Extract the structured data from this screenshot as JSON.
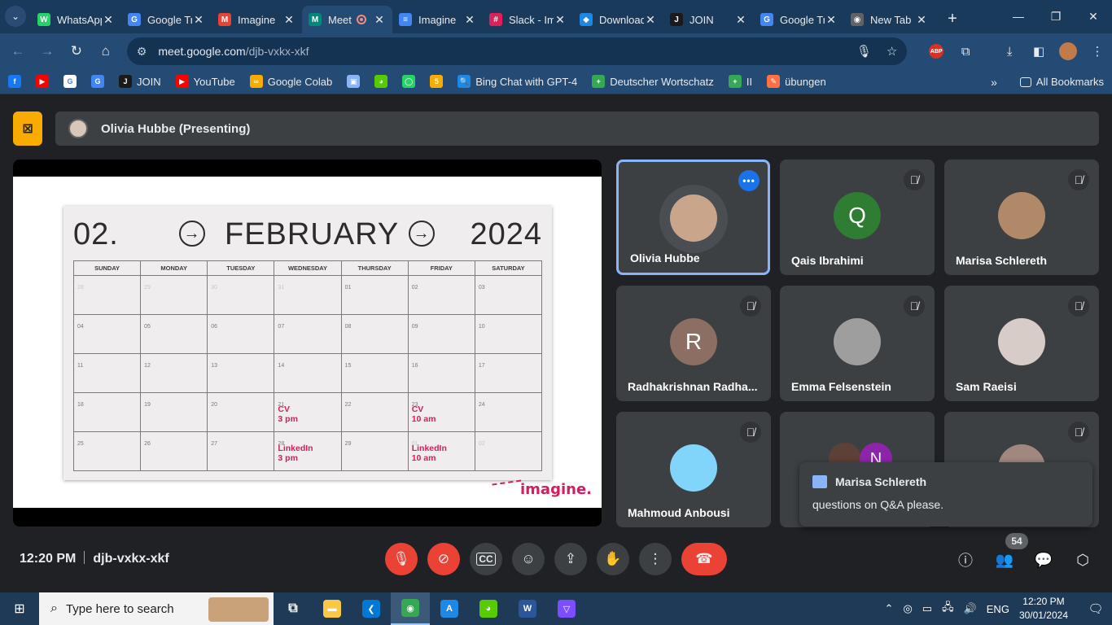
{
  "browser": {
    "tabs": [
      {
        "title": "WhatsApp",
        "icon": "whatsapp-icon",
        "color": "#25d366",
        "glyph": "W"
      },
      {
        "title": "Google Translate",
        "icon": "google-translate-icon",
        "color": "#4285f4",
        "glyph": "G"
      },
      {
        "title": "Imagine",
        "icon": "gmail-icon",
        "color": "#ea4335",
        "glyph": "M"
      },
      {
        "title": "Meet",
        "icon": "meet-icon",
        "color": "#00897b",
        "glyph": "M",
        "active": true,
        "recording": true
      },
      {
        "title": "Imagine",
        "icon": "docs-icon",
        "color": "#4285f4",
        "glyph": "≡"
      },
      {
        "title": "Slack - Imagine",
        "icon": "slack-icon",
        "color": "#e01e5a",
        "glyph": "#"
      },
      {
        "title": "Download",
        "icon": "download-site-icon",
        "color": "#1e88e5",
        "glyph": "◆"
      },
      {
        "title": "JOIN",
        "icon": "join-icon",
        "color": "#1a1a1a",
        "glyph": "J"
      },
      {
        "title": "Google Translate",
        "icon": "google-translate-icon",
        "color": "#4285f4",
        "glyph": "G"
      },
      {
        "title": "New Tab",
        "icon": "chrome-icon",
        "color": "#5f6368",
        "glyph": "◉"
      }
    ],
    "url_host": "meet.google.com",
    "url_path": "/djb-vxkx-xkf"
  },
  "bookmarks": {
    "items": [
      {
        "label": "",
        "color": "#1877f2",
        "glyph": "f"
      },
      {
        "label": "",
        "color": "#ff0000",
        "glyph": "▶"
      },
      {
        "label": "",
        "color": "#ffffff",
        "glyph": "G"
      },
      {
        "label": "",
        "color": "#4285f4",
        "glyph": "G"
      },
      {
        "label": "JOIN",
        "color": "#1a1a1a",
        "glyph": "J"
      },
      {
        "label": "YouTube",
        "color": "#ff0000",
        "glyph": "▶"
      },
      {
        "label": "Google Colab",
        "color": "#f9ab00",
        "glyph": "∞"
      },
      {
        "label": "",
        "color": "#8ab4f8",
        "glyph": "▣"
      },
      {
        "label": "",
        "color": "#58cc02",
        "glyph": "◕"
      },
      {
        "label": "",
        "color": "#25d366",
        "glyph": "◯"
      },
      {
        "label": "",
        "color": "#f9ab00",
        "glyph": "5"
      },
      {
        "label": "Bing Chat with GPT-4",
        "color": "#1e88e5",
        "glyph": "🔍"
      },
      {
        "label": "Deutscher Wortschatz",
        "color": "#34a853",
        "glyph": "+"
      },
      {
        "label": "II",
        "color": "#34a853",
        "glyph": "+"
      },
      {
        "label": "übungen",
        "color": "#ff7043",
        "glyph": "✎"
      }
    ],
    "all_bookmarks": "All Bookmarks"
  },
  "meet": {
    "presenter_label": "Olivia Hubbe (Presenting)",
    "slide": {
      "month_number": "02.",
      "month_name": "FEBRUARY",
      "year": "2024",
      "days": [
        "SUNDAY",
        "MONDAY",
        "TUESDAY",
        "WEDNESDAY",
        "THURSDAY",
        "FRIDAY",
        "SATURDAY"
      ],
      "weeks": [
        [
          {
            "d": "28",
            "faint": true
          },
          {
            "d": "29",
            "faint": true
          },
          {
            "d": "30",
            "faint": true
          },
          {
            "d": "31",
            "faint": true
          },
          {
            "d": "01"
          },
          {
            "d": "02"
          },
          {
            "d": "03"
          }
        ],
        [
          {
            "d": "04"
          },
          {
            "d": "05"
          },
          {
            "d": "06"
          },
          {
            "d": "07"
          },
          {
            "d": "08"
          },
          {
            "d": "09"
          },
          {
            "d": "10"
          }
        ],
        [
          {
            "d": "11"
          },
          {
            "d": "12"
          },
          {
            "d": "13"
          },
          {
            "d": "14"
          },
          {
            "d": "15"
          },
          {
            "d": "16"
          },
          {
            "d": "17"
          }
        ],
        [
          {
            "d": "18"
          },
          {
            "d": "19"
          },
          {
            "d": "20"
          },
          {
            "d": "21",
            "ev": "CV\n3 pm"
          },
          {
            "d": "22"
          },
          {
            "d": "23",
            "ev": "CV\n10 am"
          },
          {
            "d": "24"
          }
        ],
        [
          {
            "d": "25"
          },
          {
            "d": "26"
          },
          {
            "d": "27"
          },
          {
            "d": "28",
            "ev": "LinkedIn\n3 pm"
          },
          {
            "d": "29"
          },
          {
            "d": "01",
            "faint": true,
            "ev": "LinkedIn\n10 am"
          },
          {
            "d": "02",
            "faint": true
          }
        ]
      ],
      "brand": "imagine."
    },
    "participants": [
      {
        "name": "Olivia Hubbe",
        "speaking": true,
        "avatar_color": "#c9a58c",
        "initial": ""
      },
      {
        "name": "Qais Ibrahimi",
        "muted": true,
        "avatar_color": "#2e7d32",
        "initial": "Q"
      },
      {
        "name": "Marisa Schlereth",
        "muted": true,
        "avatar_color": "#b08968",
        "initial": ""
      },
      {
        "name": "Radhakrishnan Radha...",
        "muted": true,
        "avatar_color": "#8d6e63",
        "initial": "R"
      },
      {
        "name": "Emma Felsenstein",
        "muted": true,
        "avatar_color": "#9e9e9e",
        "initial": ""
      },
      {
        "name": "Sam Raeisi",
        "muted": true,
        "avatar_color": "#d7ccc8",
        "initial": ""
      },
      {
        "name": "Mahmoud Anbousi",
        "muted": true,
        "avatar_color": "#81d4fa",
        "initial": ""
      },
      {
        "name": "",
        "avatar_color": "#8e24aa",
        "initial": "N"
      },
      {
        "name": "",
        "muted": true,
        "avatar_color": "#a1887f",
        "initial": ""
      }
    ],
    "chat_toast": {
      "sender": "Marisa Schlereth",
      "message": "questions on Q&A please."
    },
    "time": "12:20 PM",
    "meeting_code": "djb-vxkx-xkf",
    "participant_count": "54"
  },
  "taskbar": {
    "search_placeholder": "Type here to search",
    "apps": [
      {
        "name": "task-view-icon",
        "glyph": "⧉",
        "color": ""
      },
      {
        "name": "file-explorer-icon",
        "glyph": "▬",
        "color": "#f9c846"
      },
      {
        "name": "vscode-icon",
        "glyph": "❮",
        "color": "#0078d4"
      },
      {
        "name": "chrome-icon",
        "glyph": "◉",
        "color": "#34a853",
        "active": true
      },
      {
        "name": "app-icon",
        "glyph": "A",
        "color": "#1e88e5"
      },
      {
        "name": "duolingo-icon",
        "glyph": "◕",
        "color": "#58cc02"
      },
      {
        "name": "word-icon",
        "glyph": "W",
        "color": "#2b579a"
      },
      {
        "name": "prism-icon",
        "glyph": "▽",
        "color": "#7c4dff"
      }
    ],
    "language": "ENG",
    "clock_time": "12:20 PM",
    "clock_date": "30/01/2024"
  }
}
